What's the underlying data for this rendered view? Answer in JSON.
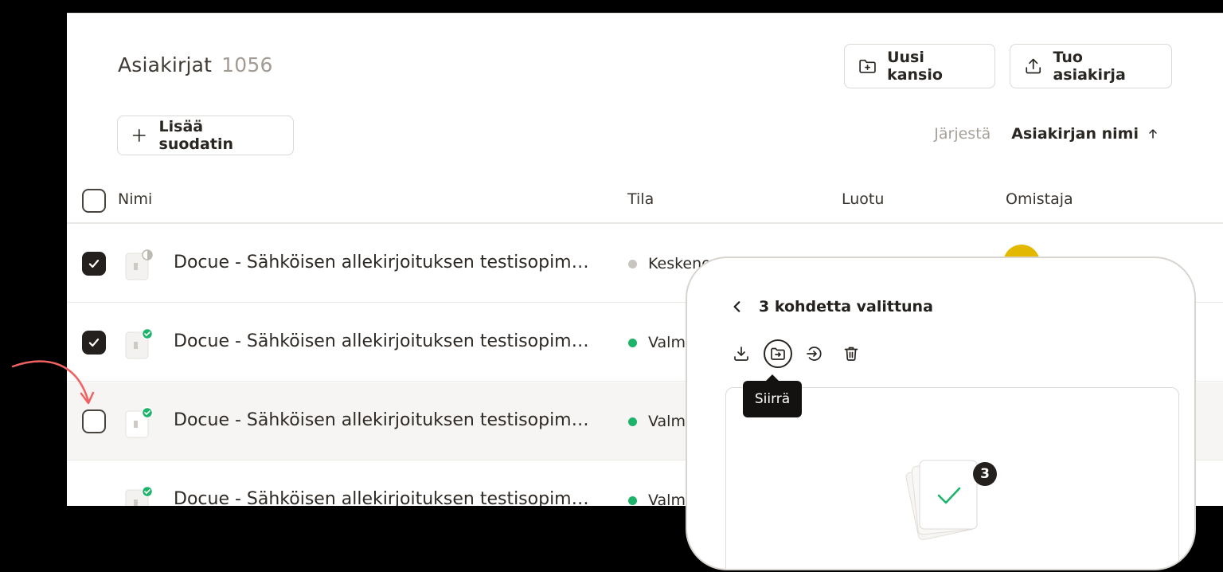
{
  "header": {
    "title": "Asiakirjat",
    "count": "1056",
    "new_folder_label": "Uusi kansio",
    "import_label": "Tuo asiakirja"
  },
  "filter": {
    "add_label": "Lisää suodatin"
  },
  "sort": {
    "label": "Järjestä",
    "value": "Asiakirjan nimi"
  },
  "table": {
    "columns": {
      "name": "Nimi",
      "status": "Tila",
      "created": "Luotu",
      "owner": "Omistaja"
    },
    "rows": [
      {
        "name": "Docue - Sähköisen allekirjoituksen testisopim…",
        "status": "Keskener",
        "checked": true
      },
      {
        "name": "Docue - Sähköisen allekirjoituksen testisopim…",
        "status": "Valm",
        "checked": true
      },
      {
        "name": "Docue - Sähköisen allekirjoituksen testisopim…",
        "status": "Valm",
        "checked": false
      },
      {
        "name": "Docue - Sähköisen allekirjoituksen testisopim…",
        "status": "Valm",
        "checked": false
      }
    ]
  },
  "panel": {
    "title": "3 kohdetta valittuna",
    "tooltip": "Siirrä",
    "badge_count": "3"
  },
  "colors": {
    "accent_green": "#1db36a",
    "avatar": "#e2b800",
    "annotation_arrow": "#f06262"
  }
}
